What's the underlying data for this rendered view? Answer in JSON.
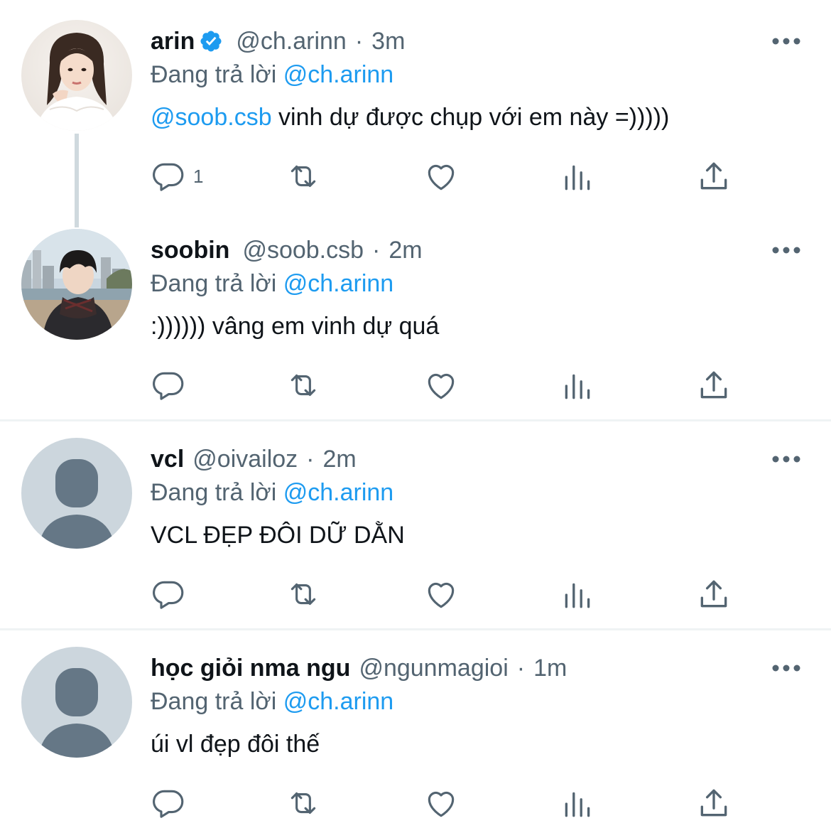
{
  "reply_prefix": "Đang trả lời",
  "icon_color": "#536471",
  "mention_color": "#1d9bf0",
  "verified_color": "#1d9bf0",
  "tweets": [
    {
      "name": "arin",
      "verified": true,
      "handle": "@ch.arinn",
      "time": "3m",
      "replying_to": "@ch.arinn",
      "mention": "@soob.csb",
      "text": " vinh dự được chụp với em này =)))))",
      "reply_count": "1",
      "avatar": "photo-woman"
    },
    {
      "name": "soobin",
      "verified": false,
      "handle": "@soob.csb",
      "time": "2m",
      "replying_to": "@ch.arinn",
      "mention": "",
      "text": ":)))))) vâng em vinh dự quá",
      "reply_count": "",
      "avatar": "photo-man-beach"
    },
    {
      "name": "vcl",
      "verified": false,
      "handle": "@oivailoz",
      "time": "2m",
      "replying_to": "@ch.arinn",
      "mention": "",
      "text": "VCL ĐẸP ĐÔI DỮ DẰN",
      "reply_count": "",
      "avatar": "default-avatar"
    },
    {
      "name": "học giỏi nma ngu",
      "verified": false,
      "handle": "@ngunmagioi",
      "time": "1m",
      "replying_to": "@ch.arinn",
      "mention": "",
      "text": "úi vl đẹp đôi thế",
      "reply_count": "",
      "avatar": "default-avatar"
    }
  ],
  "icons": [
    "reply-icon",
    "retweet-icon",
    "like-icon",
    "views-icon",
    "share-icon",
    "more-icon",
    "verified-badge-icon"
  ]
}
